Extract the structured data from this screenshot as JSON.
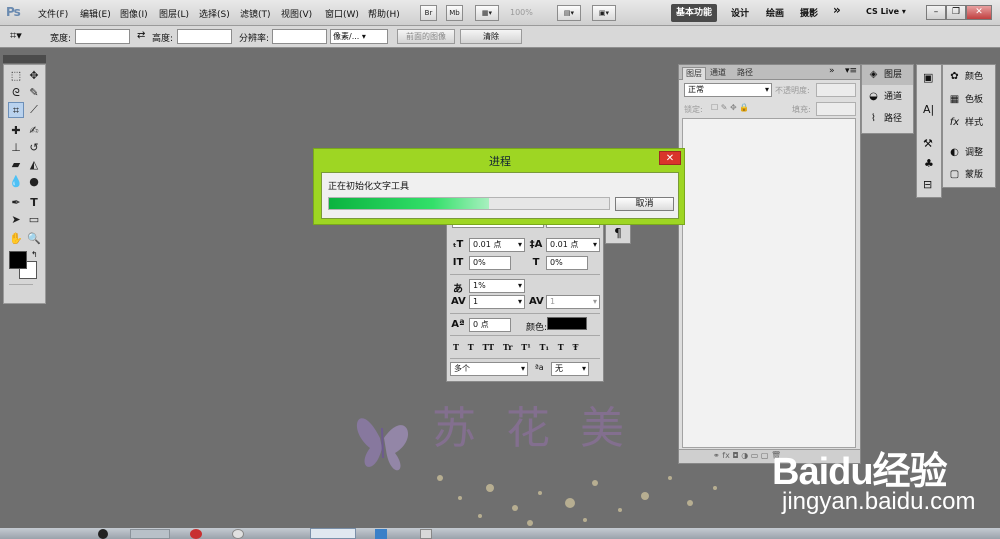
{
  "app": {
    "logo": "Ps"
  },
  "menu": [
    "文件(F)",
    "编辑(E)",
    "图像(I)",
    "图层(L)",
    "选择(S)",
    "滤镜(T)",
    "视图(V)",
    "窗口(W)",
    "帮助(H)"
  ],
  "menubar_buttons": {
    "br": "Br",
    "mb": "Mb",
    "zoom": "100%"
  },
  "workspaces": {
    "active": "基本功能",
    "items": [
      "设计",
      "绘画",
      "摄影"
    ],
    "more": "»",
    "cslive": "CS Live ▾"
  },
  "window_controls": {
    "minimize": "–",
    "restore": "❐",
    "close": "✕"
  },
  "options": {
    "width_label": "宽度:",
    "height_label": "高度:",
    "resolution_label": "分辨率:",
    "unit_value": "像素/...",
    "front_image_btn": "前面的图像",
    "clear_btn": "清除"
  },
  "layers_panel": {
    "tabs": [
      "图层",
      "通道",
      "路径"
    ],
    "blend_mode": "正常",
    "opacity_label": "不透明度:",
    "lock_label": "锁定:",
    "fill_label": "填充:",
    "footer_icons": "⚭  fx  ◘  ◑  ▭  ▢  🗑"
  },
  "dock": {
    "group1": [
      {
        "icon": "◈",
        "label": "图层"
      },
      {
        "icon": "◒",
        "label": "通道"
      },
      {
        "icon": "⌇",
        "label": "路径"
      }
    ],
    "group3": [
      {
        "icon": "✿",
        "label": "颜色"
      },
      {
        "icon": "▦",
        "label": "色板"
      },
      {
        "icon": "fx",
        "label": "样式"
      },
      {
        "icon": "◐",
        "label": "调整"
      },
      {
        "icon": "▢",
        "label": "蒙版"
      }
    ]
  },
  "character_panel": {
    "size": "0.01 点",
    "leading": "0.01 点",
    "vscale": "0%",
    "hscale": "0%",
    "tracking_pct": "1%",
    "kerning": "1",
    "tracking": "1",
    "baseline": "0 点",
    "color_label": "颜色:",
    "styles": "T T TT Tr T¹ T₁ T Ŧ",
    "language": "多个",
    "aa_label": "ªa",
    "antialias": "无",
    "paragraph_icon": "¶"
  },
  "dialog": {
    "title": "进程",
    "message": "正在初始化文字工具",
    "cancel": "取消",
    "progress": 0.57
  },
  "watermark": {
    "text": "苏 花 美",
    "baidu": "Baidu经验",
    "baidu_url": "jingyan.baidu.com"
  }
}
